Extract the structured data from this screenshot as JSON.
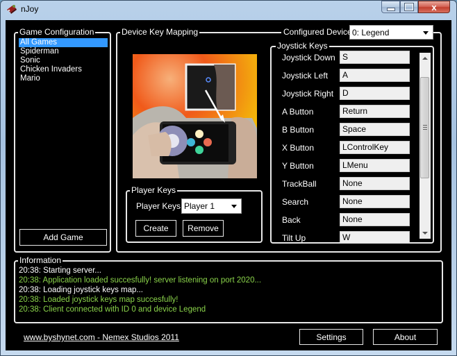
{
  "window": {
    "title": "nJoy",
    "icon": "joystick-app-icon",
    "controls": {
      "minimize": "minimize",
      "maximize": "maximize",
      "close": "x"
    }
  },
  "game_configuration": {
    "label": "Game Configuration",
    "games": [
      {
        "name": "All Games",
        "selected": true
      },
      {
        "name": "Spiderman",
        "selected": false
      },
      {
        "name": "Sonic",
        "selected": false
      },
      {
        "name": "Chicken Invaders",
        "selected": false
      },
      {
        "name": "Mario",
        "selected": false
      }
    ],
    "add_button": "Add Game"
  },
  "device_key_mapping": {
    "label": "Device Key Mapping",
    "configured_device_label": "Configured Device:",
    "configured_device_value": "0: Legend",
    "image": "phone-gamepad-illustration"
  },
  "player_keys": {
    "label": "Player Keys",
    "field_label": "Player Keys:",
    "selected": "Player 1",
    "create_button": "Create",
    "remove_button": "Remove"
  },
  "joystick_keys": {
    "label": "Joystick Keys",
    "rows": [
      {
        "name": "Joystick Down",
        "value": "S"
      },
      {
        "name": "Joystick Left",
        "value": "A"
      },
      {
        "name": "Joystick Right",
        "value": "D"
      },
      {
        "name": "A Button",
        "value": "Return"
      },
      {
        "name": "B Button",
        "value": "Space"
      },
      {
        "name": "X Button",
        "value": "LControlKey"
      },
      {
        "name": "Y Button",
        "value": "LMenu"
      },
      {
        "name": "TrackBall",
        "value": "None"
      },
      {
        "name": "Search",
        "value": "None"
      },
      {
        "name": "Back",
        "value": "None"
      },
      {
        "name": "Tilt Up",
        "value": "W"
      }
    ]
  },
  "information": {
    "label": "Information",
    "log": [
      {
        "text": "20:38: Starting server...",
        "color": "#ffffff"
      },
      {
        "text": "20:38: Application loaded succesfully! server listening on port 2020...",
        "color": "#8ad34a"
      },
      {
        "text": "20:38: Loading joystick keys map...",
        "color": "#ffffff"
      },
      {
        "text": "20:38: Loaded joystick keys map succesfully!",
        "color": "#8ad34a"
      },
      {
        "text": "20:38: Client connected with ID 0 and device Legend",
        "color": "#8ad34a"
      }
    ]
  },
  "footer": {
    "link": "www.byshynet.com - Nemex Studios 2011",
    "settings_button": "Settings",
    "about_button": "About"
  },
  "colors": {
    "selection": "#3399ff",
    "log_success": "#8ad34a",
    "background": "#000000"
  }
}
